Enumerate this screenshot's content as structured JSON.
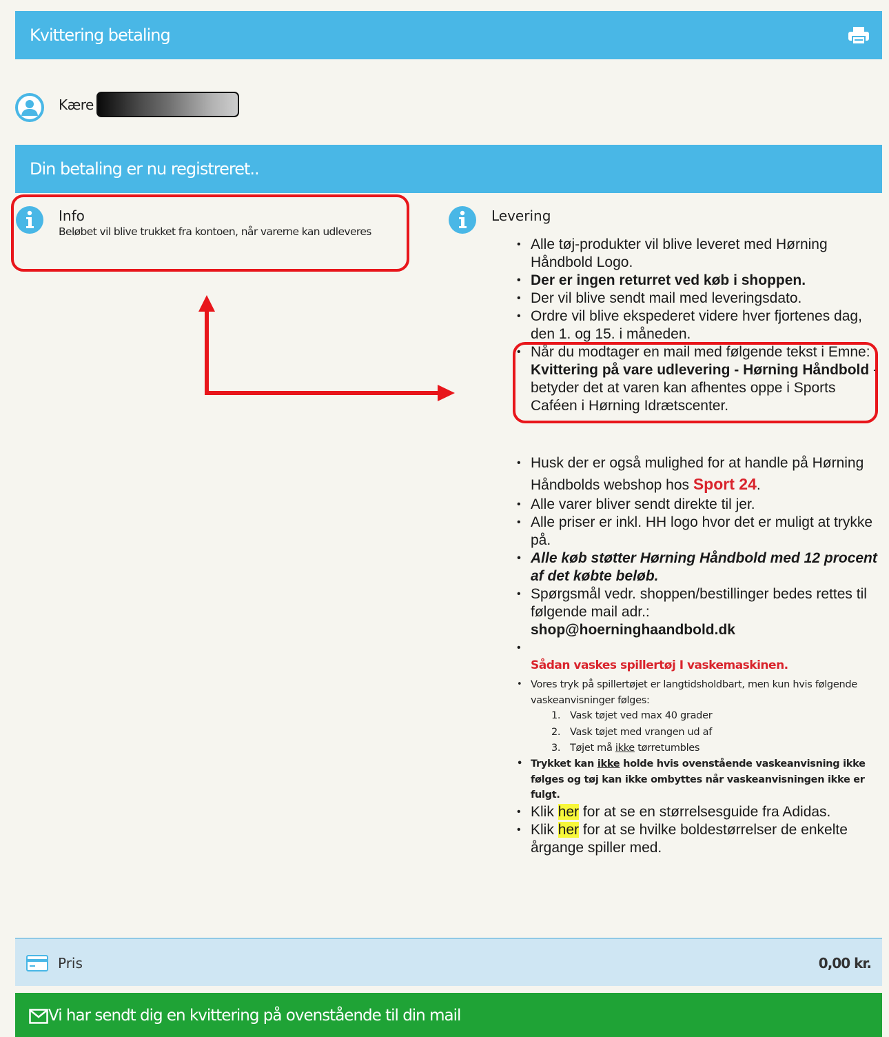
{
  "header": {
    "title": "Kvittering betaling",
    "print_icon": "print-icon"
  },
  "greeting": {
    "prefix": "Kære"
  },
  "status": {
    "text": "Din betaling er nu registreret.."
  },
  "info": {
    "title": "Info",
    "text": "Beløbet vil blive trukket fra kontoen, når varerne kan udleveres"
  },
  "levering": {
    "title": "Levering",
    "items_a": [
      "Alle tøj-produkter vil blive leveret med Hørning Håndbold Logo.",
      "Der er ingen returret ved køb i shoppen.",
      "Der vil blive sendt mail med leveringsdato.",
      "Ordre vil blive ekspederet videre hver fjortenes dag, den 1. og 15. i måneden."
    ],
    "boxed": {
      "part1": "Når du modtager en mail med følgende tekst i Emne: ",
      "bold": "Kvittering på vare udlevering - Hørning Håndbold",
      "part2": " -betyder det at varen kan afhentes oppe i Sports Caféen i Hørning Idrætscenter."
    },
    "items_b": {
      "webshop_pre": "Husk der er også mulighed for at handle på Hørning Håndbolds webshop hos ",
      "webshop_link": "Sport 24",
      "webshop_post": ".",
      "direct": "Alle varer bliver sendt direkte til jer.",
      "prices": "Alle priser er inkl. HH logo hvor det er muligt at trykke på.",
      "support": "Alle køb støtter Hørning Håndbold med 12 procent af det købte beløb.",
      "questions": "Spørgsmål vedr. shoppen/bestillinger bedes rettes til følgende mail adr.:",
      "email": "shop@hoerninghaandbold.dk"
    },
    "wash": {
      "heading": "Sådan vaskes spillertøj I vaskemaskinen.",
      "intro": "Vores tryk på spillertøjet er langtidsholdbart, men kun hvis følgende vaskeanvisninger følges:",
      "steps": [
        {
          "n": "1.",
          "pre": "Vask tøjet ved max 40 grader",
          "u": "",
          "post": ""
        },
        {
          "n": "2.",
          "pre": "Vask tøjet med vrangen ud af",
          "u": "",
          "post": ""
        },
        {
          "n": "3.",
          "pre": "Tøjet må ",
          "u": "ikke",
          "post": " tørretumbles"
        }
      ],
      "warning_pre": "Trykket kan ",
      "warning_u": "ikke",
      "warning_post": " holde hvis ovenstående vaskeanvisning ikke følges og tøj kan ikke ombyttes når vaskeanvisningen ikke er fulgt."
    },
    "links": {
      "klik": "Klik",
      "her": "her",
      "size_text": " for at se en størrelsesguide fra Adidas.",
      "ball_text": " for at se hvilke boldestørrelser de enkelte årgange spiller med."
    }
  },
  "price": {
    "label": "Pris",
    "value": "0,00 kr.",
    "icon": "credit-card-icon"
  },
  "confirmation": {
    "text": "Vi har sendt dig en kvittering på ovenstående til din mail",
    "icon": "envelope-icon"
  },
  "colors": {
    "header_blue": "#49b7e6",
    "annotation_red": "#e8161b",
    "confirm_green": "#1fa336",
    "price_bar": "#cfe6f3",
    "highlight_yellow": "#f7f73a"
  }
}
